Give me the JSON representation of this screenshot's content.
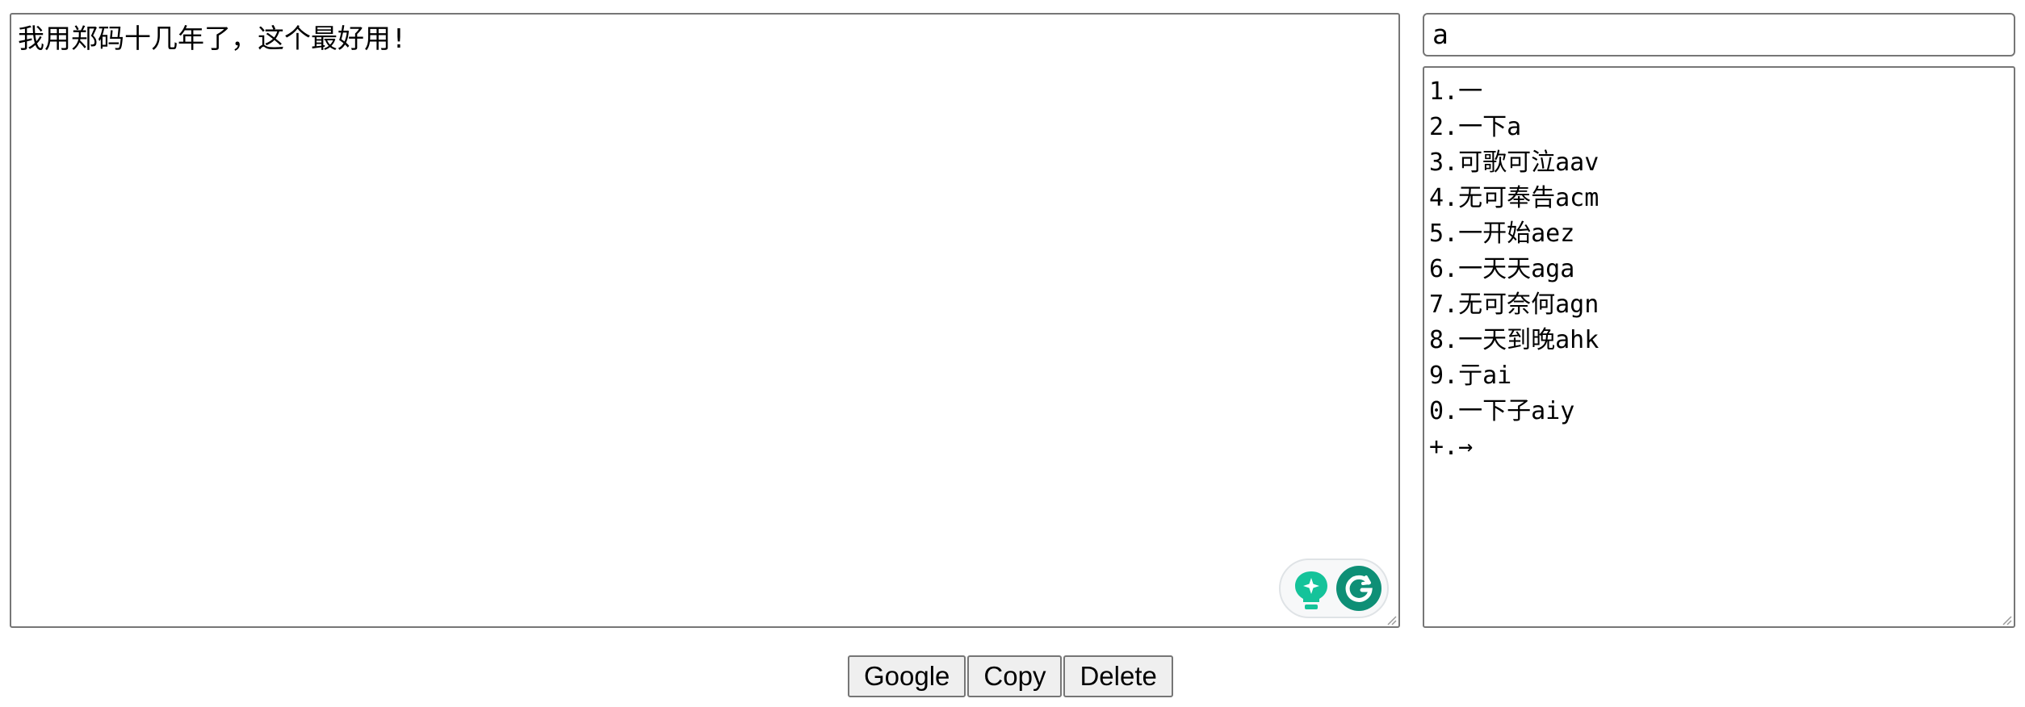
{
  "editor": {
    "text": "我用郑码十几年了，这个最好用!"
  },
  "code_input": {
    "value": "a"
  },
  "candidates": [
    "1.一",
    "2.一下a",
    "3.可歌可泣aav",
    "4.无可奉告acm",
    "5.一开始aez",
    "6.一天天aga",
    "7.无可奈何agn",
    "8.一天到晚ahk",
    "9.亍ai",
    "0.一下子aiy",
    "+.→"
  ],
  "buttons": {
    "google": "Google",
    "copy": "Copy",
    "delete": "Delete"
  },
  "colors": {
    "grammarly_teal": "#15c39a",
    "grammarly_dark": "#0e8f76",
    "border": "#767676"
  }
}
